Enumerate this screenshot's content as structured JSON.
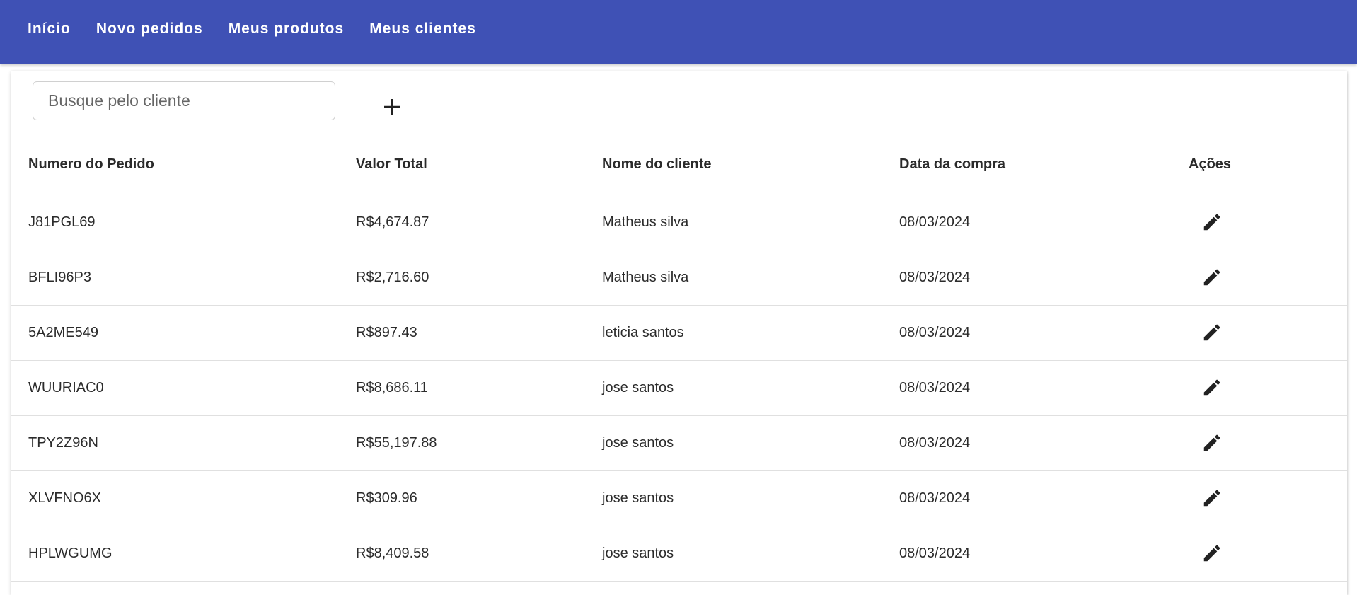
{
  "nav": {
    "items": [
      {
        "label": "Início"
      },
      {
        "label": "Novo pedidos"
      },
      {
        "label": "Meus produtos"
      },
      {
        "label": "Meus clientes"
      }
    ]
  },
  "search": {
    "placeholder": "Busque pelo cliente",
    "value": ""
  },
  "add_button": {
    "icon": "plus-icon"
  },
  "table": {
    "headers": [
      "Numero do Pedido",
      "Valor Total",
      "Nome do cliente",
      "Data da compra",
      "Ações"
    ],
    "rows": [
      {
        "order": "J81PGL69",
        "total": "R$4,674.87",
        "client": "Matheus silva",
        "date": "08/03/2024",
        "action_icon": "edit-icon"
      },
      {
        "order": "BFLI96P3",
        "total": "R$2,716.60",
        "client": "Matheus silva",
        "date": "08/03/2024",
        "action_icon": "edit-icon"
      },
      {
        "order": "5A2ME549",
        "total": "R$897.43",
        "client": "leticia santos",
        "date": "08/03/2024",
        "action_icon": "edit-icon"
      },
      {
        "order": "WUURIAC0",
        "total": "R$8,686.11",
        "client": "jose santos",
        "date": "08/03/2024",
        "action_icon": "edit-icon"
      },
      {
        "order": "TPY2Z96N",
        "total": "R$55,197.88",
        "client": "jose santos",
        "date": "08/03/2024",
        "action_icon": "edit-icon"
      },
      {
        "order": "XLVFNO6X",
        "total": "R$309.96",
        "client": "jose santos",
        "date": "08/03/2024",
        "action_icon": "edit-icon"
      },
      {
        "order": "HPLWGUMG",
        "total": "R$8,409.58",
        "client": "jose santos",
        "date": "08/03/2024",
        "action_icon": "edit-icon"
      }
    ]
  },
  "colors": {
    "topbar": "#3f51b5",
    "text": "#2b2b2b"
  }
}
